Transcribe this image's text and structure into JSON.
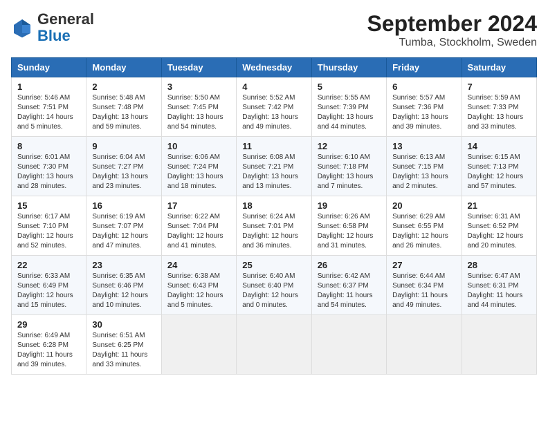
{
  "header": {
    "logo_general": "General",
    "logo_blue": "Blue",
    "title": "September 2024",
    "subtitle": "Tumba, Stockholm, Sweden"
  },
  "weekdays": [
    "Sunday",
    "Monday",
    "Tuesday",
    "Wednesday",
    "Thursday",
    "Friday",
    "Saturday"
  ],
  "weeks": [
    [
      {
        "day": "1",
        "sunrise": "Sunrise: 5:46 AM",
        "sunset": "Sunset: 7:51 PM",
        "daylight": "Daylight: 14 hours and 5 minutes."
      },
      {
        "day": "2",
        "sunrise": "Sunrise: 5:48 AM",
        "sunset": "Sunset: 7:48 PM",
        "daylight": "Daylight: 13 hours and 59 minutes."
      },
      {
        "day": "3",
        "sunrise": "Sunrise: 5:50 AM",
        "sunset": "Sunset: 7:45 PM",
        "daylight": "Daylight: 13 hours and 54 minutes."
      },
      {
        "day": "4",
        "sunrise": "Sunrise: 5:52 AM",
        "sunset": "Sunset: 7:42 PM",
        "daylight": "Daylight: 13 hours and 49 minutes."
      },
      {
        "day": "5",
        "sunrise": "Sunrise: 5:55 AM",
        "sunset": "Sunset: 7:39 PM",
        "daylight": "Daylight: 13 hours and 44 minutes."
      },
      {
        "day": "6",
        "sunrise": "Sunrise: 5:57 AM",
        "sunset": "Sunset: 7:36 PM",
        "daylight": "Daylight: 13 hours and 39 minutes."
      },
      {
        "day": "7",
        "sunrise": "Sunrise: 5:59 AM",
        "sunset": "Sunset: 7:33 PM",
        "daylight": "Daylight: 13 hours and 33 minutes."
      }
    ],
    [
      {
        "day": "8",
        "sunrise": "Sunrise: 6:01 AM",
        "sunset": "Sunset: 7:30 PM",
        "daylight": "Daylight: 13 hours and 28 minutes."
      },
      {
        "day": "9",
        "sunrise": "Sunrise: 6:04 AM",
        "sunset": "Sunset: 7:27 PM",
        "daylight": "Daylight: 13 hours and 23 minutes."
      },
      {
        "day": "10",
        "sunrise": "Sunrise: 6:06 AM",
        "sunset": "Sunset: 7:24 PM",
        "daylight": "Daylight: 13 hours and 18 minutes."
      },
      {
        "day": "11",
        "sunrise": "Sunrise: 6:08 AM",
        "sunset": "Sunset: 7:21 PM",
        "daylight": "Daylight: 13 hours and 13 minutes."
      },
      {
        "day": "12",
        "sunrise": "Sunrise: 6:10 AM",
        "sunset": "Sunset: 7:18 PM",
        "daylight": "Daylight: 13 hours and 7 minutes."
      },
      {
        "day": "13",
        "sunrise": "Sunrise: 6:13 AM",
        "sunset": "Sunset: 7:15 PM",
        "daylight": "Daylight: 13 hours and 2 minutes."
      },
      {
        "day": "14",
        "sunrise": "Sunrise: 6:15 AM",
        "sunset": "Sunset: 7:13 PM",
        "daylight": "Daylight: 12 hours and 57 minutes."
      }
    ],
    [
      {
        "day": "15",
        "sunrise": "Sunrise: 6:17 AM",
        "sunset": "Sunset: 7:10 PM",
        "daylight": "Daylight: 12 hours and 52 minutes."
      },
      {
        "day": "16",
        "sunrise": "Sunrise: 6:19 AM",
        "sunset": "Sunset: 7:07 PM",
        "daylight": "Daylight: 12 hours and 47 minutes."
      },
      {
        "day": "17",
        "sunrise": "Sunrise: 6:22 AM",
        "sunset": "Sunset: 7:04 PM",
        "daylight": "Daylight: 12 hours and 41 minutes."
      },
      {
        "day": "18",
        "sunrise": "Sunrise: 6:24 AM",
        "sunset": "Sunset: 7:01 PM",
        "daylight": "Daylight: 12 hours and 36 minutes."
      },
      {
        "day": "19",
        "sunrise": "Sunrise: 6:26 AM",
        "sunset": "Sunset: 6:58 PM",
        "daylight": "Daylight: 12 hours and 31 minutes."
      },
      {
        "day": "20",
        "sunrise": "Sunrise: 6:29 AM",
        "sunset": "Sunset: 6:55 PM",
        "daylight": "Daylight: 12 hours and 26 minutes."
      },
      {
        "day": "21",
        "sunrise": "Sunrise: 6:31 AM",
        "sunset": "Sunset: 6:52 PM",
        "daylight": "Daylight: 12 hours and 20 minutes."
      }
    ],
    [
      {
        "day": "22",
        "sunrise": "Sunrise: 6:33 AM",
        "sunset": "Sunset: 6:49 PM",
        "daylight": "Daylight: 12 hours and 15 minutes."
      },
      {
        "day": "23",
        "sunrise": "Sunrise: 6:35 AM",
        "sunset": "Sunset: 6:46 PM",
        "daylight": "Daylight: 12 hours and 10 minutes."
      },
      {
        "day": "24",
        "sunrise": "Sunrise: 6:38 AM",
        "sunset": "Sunset: 6:43 PM",
        "daylight": "Daylight: 12 hours and 5 minutes."
      },
      {
        "day": "25",
        "sunrise": "Sunrise: 6:40 AM",
        "sunset": "Sunset: 6:40 PM",
        "daylight": "Daylight: 12 hours and 0 minutes."
      },
      {
        "day": "26",
        "sunrise": "Sunrise: 6:42 AM",
        "sunset": "Sunset: 6:37 PM",
        "daylight": "Daylight: 11 hours and 54 minutes."
      },
      {
        "day": "27",
        "sunrise": "Sunrise: 6:44 AM",
        "sunset": "Sunset: 6:34 PM",
        "daylight": "Daylight: 11 hours and 49 minutes."
      },
      {
        "day": "28",
        "sunrise": "Sunrise: 6:47 AM",
        "sunset": "Sunset: 6:31 PM",
        "daylight": "Daylight: 11 hours and 44 minutes."
      }
    ],
    [
      {
        "day": "29",
        "sunrise": "Sunrise: 6:49 AM",
        "sunset": "Sunset: 6:28 PM",
        "daylight": "Daylight: 11 hours and 39 minutes."
      },
      {
        "day": "30",
        "sunrise": "Sunrise: 6:51 AM",
        "sunset": "Sunset: 6:25 PM",
        "daylight": "Daylight: 11 hours and 33 minutes."
      },
      null,
      null,
      null,
      null,
      null
    ]
  ]
}
